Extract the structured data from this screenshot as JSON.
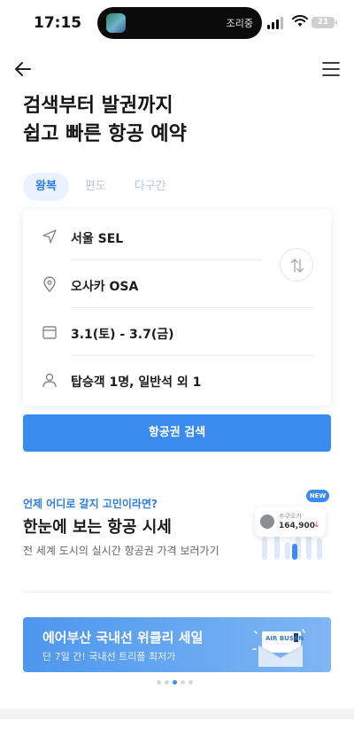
{
  "status_bar": {
    "time": "17:15",
    "island_text": "조리중",
    "battery": "21"
  },
  "headline": {
    "line1": "검색부터 발권까지",
    "line2": "쉽고 빠른 항공 예약"
  },
  "tabs": [
    {
      "label": "왕복",
      "active": true
    },
    {
      "label": "편도",
      "active": false
    },
    {
      "label": "다구간",
      "active": false
    }
  ],
  "form": {
    "departure": "서울 SEL",
    "arrival": "오사카 OSA",
    "dates": "3.1(토) - 3.7(금)",
    "passengers": "탑승객 1명, 일반석 외 1"
  },
  "search_button": "항공권 검색",
  "promo": {
    "subtitle": "언제 어디로 갈지 고민이라면?",
    "title": "한눈에 보는 항공 시세",
    "description": "전 세계 도시의 실시간 항공권 가격 보러가기",
    "badge": "NEW",
    "mini_card": {
      "city": "후쿠오카",
      "price": "164,900",
      "trend": "↓"
    }
  },
  "banner": {
    "title": "에어부산 국내선 위클리 세일",
    "subtitle": "단 7일 간! 국내선 트리플 최저가",
    "brand": "AIR BUSAN"
  },
  "pagination": {
    "count": 5,
    "active_index": 2
  },
  "colors": {
    "accent": "#3b8bef",
    "tab_active_bg": "#e9f2fd"
  }
}
